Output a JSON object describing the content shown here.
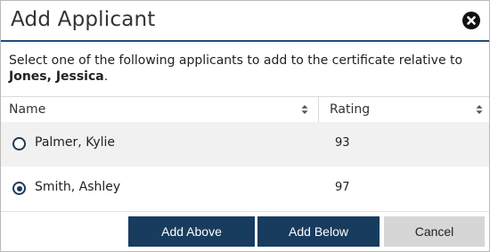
{
  "dialog": {
    "title": "Add Applicant",
    "instructions_prefix": "Select one of the following applicants to add to the certificate relative to",
    "instructions_name": "Jones, Jessica",
    "instructions_suffix": "."
  },
  "grid": {
    "columns": [
      "Name",
      "Rating"
    ],
    "rows": [
      {
        "name": "Palmer, Kylie",
        "rating": "93",
        "selected": false
      },
      {
        "name": "Smith, Ashley",
        "rating": "97",
        "selected": true
      }
    ]
  },
  "buttons": {
    "add_above": "Add Above",
    "add_below": "Add Below",
    "cancel": "Cancel"
  },
  "icons": {
    "close": "close-circle-icon",
    "sort": "sort-updown-icon"
  },
  "colors": {
    "primary": "#183c5e",
    "header_rule": "#1f4e79",
    "row_alt": "#f1f1f1",
    "cancel_bg": "#d6d6d6"
  }
}
